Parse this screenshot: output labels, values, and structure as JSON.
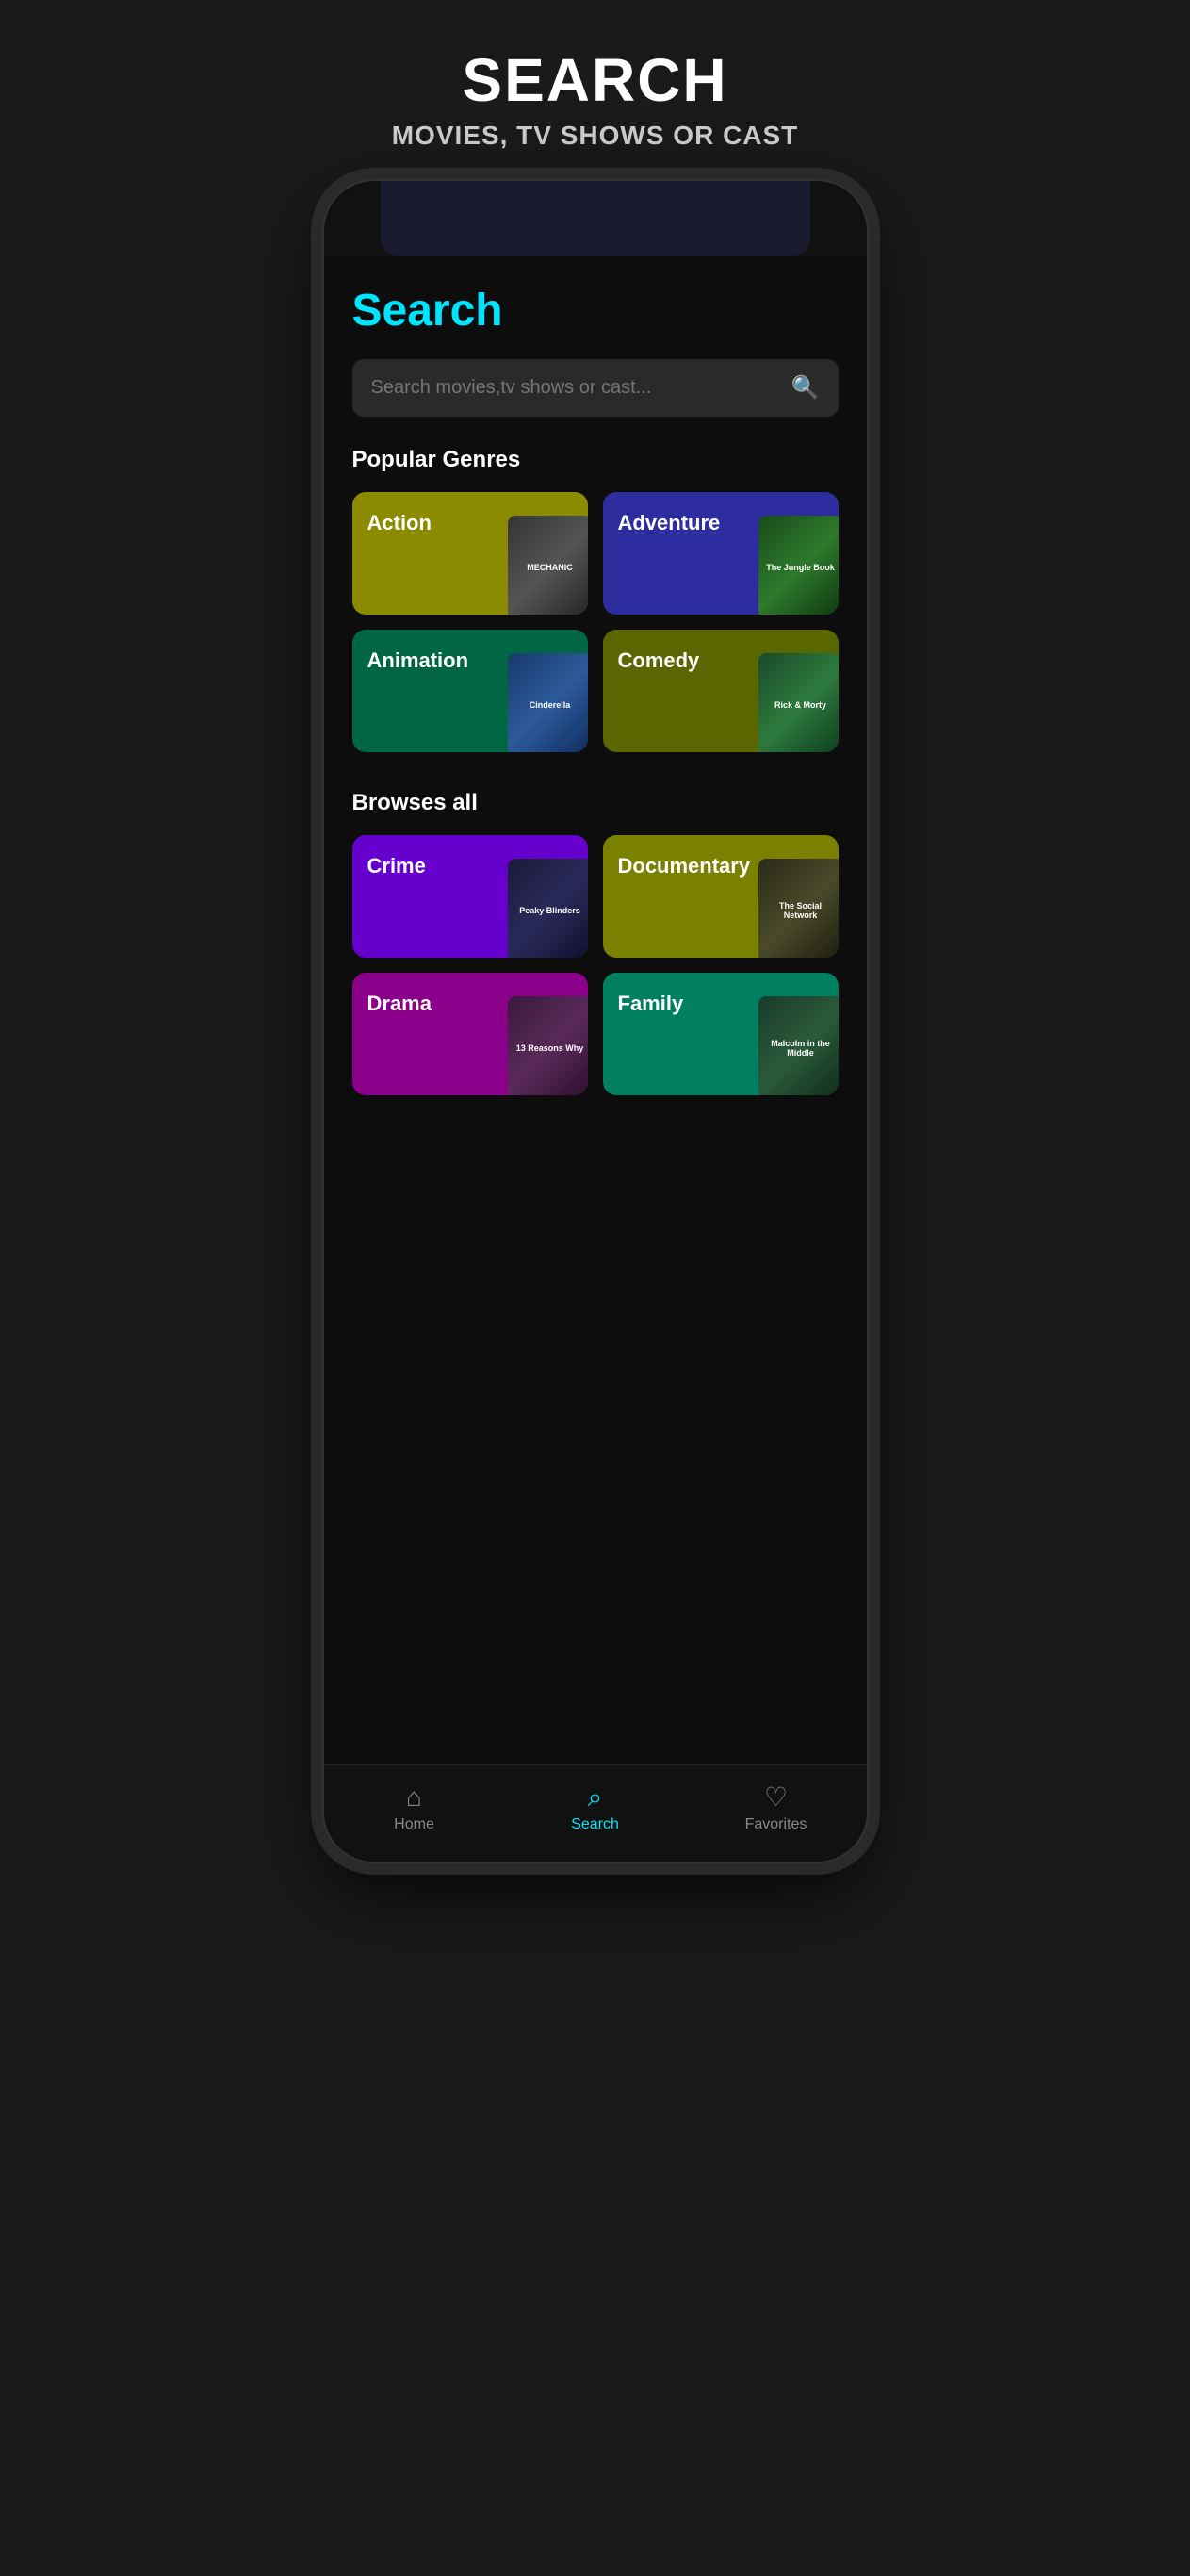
{
  "banner": {
    "title": "SEARCH",
    "subtitle": "MOVIES, TV SHOWS OR CAST"
  },
  "page": {
    "title": "Search"
  },
  "searchBar": {
    "placeholder": "Search movies,tv shows or cast..."
  },
  "sections": {
    "popularGenres": {
      "label": "Popular Genres",
      "genres": [
        {
          "id": "action",
          "name": "Action",
          "colorClass": "card-action",
          "posterClass": "poster-mechanic",
          "posterText": "MECHANIC"
        },
        {
          "id": "adventure",
          "name": "Adventure",
          "colorClass": "card-adventure",
          "posterClass": "poster-jungle",
          "posterText": "The Jungle Book"
        },
        {
          "id": "animation",
          "name": "Animation",
          "colorClass": "card-animation",
          "posterClass": "poster-cinderella",
          "posterText": "Cinderella"
        },
        {
          "id": "comedy",
          "name": "Comedy",
          "colorClass": "card-comedy",
          "posterClass": "poster-rick",
          "posterText": "Rick & Morty"
        }
      ]
    },
    "browsesAll": {
      "label": "Browses all",
      "genres": [
        {
          "id": "crime",
          "name": "Crime",
          "colorClass": "card-crime",
          "posterClass": "poster-peaky",
          "posterText": "Peaky Blinders"
        },
        {
          "id": "documentary",
          "name": "Documentary",
          "colorClass": "card-documentary",
          "posterClass": "poster-social",
          "posterText": "The Social Network"
        },
        {
          "id": "drama",
          "name": "Drama",
          "colorClass": "card-drama",
          "posterClass": "poster-drama",
          "posterText": "13 Reasons Why"
        },
        {
          "id": "family",
          "name": "Family",
          "colorClass": "card-family",
          "posterClass": "poster-malcolm",
          "posterText": "Malcolm in the Middle"
        }
      ]
    }
  },
  "bottomNav": {
    "items": [
      {
        "id": "home",
        "label": "Home",
        "icon": "⌂",
        "active": false
      },
      {
        "id": "search",
        "label": "Search",
        "icon": "⌕",
        "active": true
      },
      {
        "id": "favorites",
        "label": "Favorites",
        "icon": "♡",
        "active": false
      }
    ]
  }
}
